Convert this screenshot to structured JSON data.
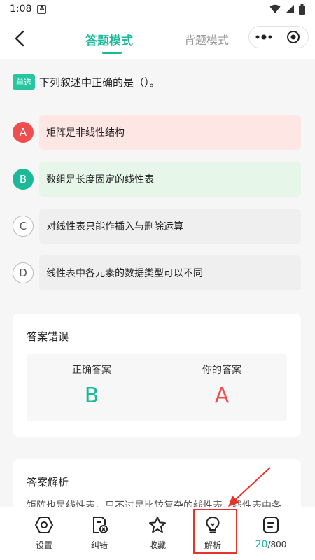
{
  "status": {
    "time": "1:08",
    "badge": "A"
  },
  "nav": {
    "tab_answer": "答题模式",
    "tab_recite": "背题模式"
  },
  "question": {
    "type_tag": "单选",
    "text": "下列叙述中正确的是（）。"
  },
  "options": [
    {
      "letter": "A",
      "text": "矩阵是非线性结构",
      "state": "wrong-selected"
    },
    {
      "letter": "B",
      "text": "数组是长度固定的线性表",
      "state": "correct"
    },
    {
      "letter": "C",
      "text": "对线性表只能作插入与删除运算",
      "state": "normal"
    },
    {
      "letter": "D",
      "text": "线性表中各元素的数据类型可以不同",
      "state": "normal"
    }
  ],
  "result": {
    "title": "答案错误",
    "correct_label": "正确答案",
    "correct_value": "B",
    "yours_label": "你的答案",
    "yours_value": "A"
  },
  "analysis": {
    "title": "答案解析",
    "text": "矩阵也是线性表，只不过是比较复杂的线性表，线性表中各"
  },
  "bottom_bar": {
    "settings": "设置",
    "correct_error": "纠错",
    "favorite": "收藏",
    "analysis": "解析",
    "progress_current": "20",
    "progress_total": "/800"
  },
  "colors": {
    "accent": "#1bb99a",
    "wrong": "#f04e4e",
    "highlight": "#e8332b"
  }
}
